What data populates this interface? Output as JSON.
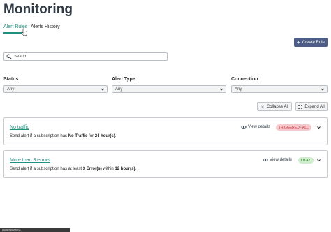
{
  "page": {
    "title": "Monitoring"
  },
  "tabs": [
    {
      "label": "Alert Rules",
      "active": true
    },
    {
      "label": "Alerts History",
      "active": false
    }
  ],
  "toolbar": {
    "create_rule_label": "Create Rule"
  },
  "search": {
    "placeholder": "Search",
    "value": ""
  },
  "filters": [
    {
      "label": "Status",
      "value": "Any"
    },
    {
      "label": "Alert Type",
      "value": "Any"
    },
    {
      "label": "Connection",
      "value": "Any"
    }
  ],
  "actions": {
    "collapse_all_label": "Collapse All",
    "expand_all_label": "Expand All"
  },
  "rules": [
    {
      "name": "No traffic",
      "desc_prefix": "Send alert if a subscription has ",
      "desc_bold_1": "No Traffic",
      "desc_mid": " for ",
      "desc_bold_2": "24 hour(s)",
      "desc_suffix": ".",
      "view_details_label": "View details",
      "status": "TRIGGERED - ALL",
      "status_color": "#c0323f"
    },
    {
      "name": "More than 3 errors",
      "desc_prefix": "Send alert if a subscription has at least ",
      "desc_bold_1": "3 Error(s)",
      "desc_mid": " within ",
      "desc_bold_2": "12 hour(s)",
      "desc_suffix": ".",
      "view_details_label": "View details",
      "status": "OKAY",
      "status_color": "#2f7a2c"
    }
  ],
  "status_bar": {
    "text": "javascript:void(0)"
  },
  "colors": {
    "accent": "#1f8f80",
    "primary_button": "#4e5d87"
  }
}
